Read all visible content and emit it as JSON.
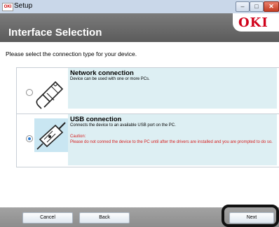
{
  "window": {
    "title": "Setup",
    "app_icon_text": "OKI",
    "minimize_icon": "minimize-icon",
    "maximize_icon": "maximize-icon",
    "close_icon": "close-icon"
  },
  "header": {
    "heading": "Interface Selection",
    "logo": "OKI",
    "logo_color": "#d0021b"
  },
  "prompt": "Please select the connection type for your device.",
  "options": [
    {
      "title": "Network connection",
      "description": "Device can be used with one or more PCs.",
      "selected": false,
      "icon": "network-connector-icon"
    },
    {
      "title": "USB connection",
      "description": "Connects the device to an available USB port on the PC.",
      "caution_label": "Caution:",
      "caution_text": "Please do not conned the device to the PC until after the drivers are installed and you are prompted to do so.",
      "selected": true,
      "icon": "usb-cable-icon"
    }
  ],
  "buttons": {
    "cancel": "Cancel",
    "back": "Back",
    "next": "Next"
  },
  "colors": {
    "accent": "#2a7ad0",
    "caution": "#d62020",
    "panel": "#ddeff3"
  }
}
